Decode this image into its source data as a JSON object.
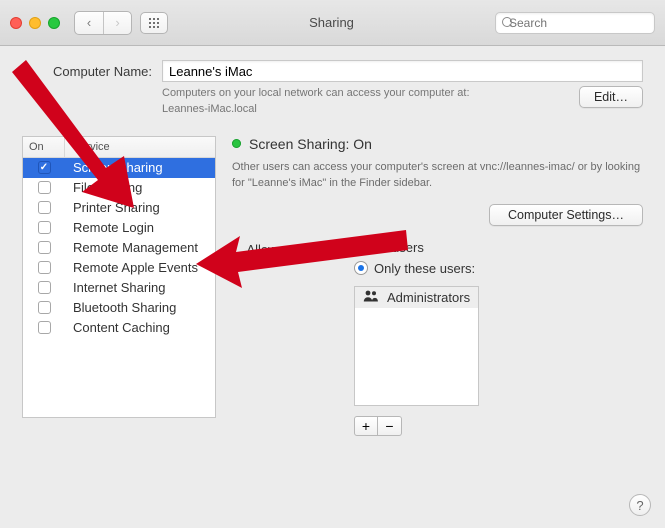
{
  "window": {
    "title": "Sharing",
    "search_placeholder": "Search"
  },
  "computer_name_label": "Computer Name:",
  "computer_name_value": "Leanne's iMac",
  "hint_line1": "Computers on your local network can access your computer at:",
  "hint_line2": "Leannes-iMac.local",
  "edit_button": "Edit…",
  "table": {
    "head_on": "On",
    "head_service": "Service"
  },
  "services": [
    {
      "label": "Screen Sharing",
      "on": true,
      "selected": true
    },
    {
      "label": "File Sharing",
      "on": false,
      "selected": false
    },
    {
      "label": "Printer Sharing",
      "on": false,
      "selected": false
    },
    {
      "label": "Remote Login",
      "on": false,
      "selected": false
    },
    {
      "label": "Remote Management",
      "on": false,
      "selected": false
    },
    {
      "label": "Remote Apple Events",
      "on": false,
      "selected": false
    },
    {
      "label": "Internet Sharing",
      "on": false,
      "selected": false
    },
    {
      "label": "Bluetooth Sharing",
      "on": false,
      "selected": false
    },
    {
      "label": "Content Caching",
      "on": false,
      "selected": false
    }
  ],
  "status_title": "Screen Sharing: On",
  "status_desc": "Other users can access your computer's screen at vnc://leannes-imac/ or by looking for \"Leanne's iMac\" in the Finder sidebar.",
  "computer_settings_button": "Computer Settings…",
  "access": {
    "label": "Allow access for:",
    "all": "All users",
    "only": "Only these users:",
    "selected": "only"
  },
  "users": [
    {
      "label": "Administrators"
    }
  ],
  "colors": {
    "accent": "#2f6fe0",
    "status_green": "#29c440",
    "arrow_red": "#d0021b"
  }
}
